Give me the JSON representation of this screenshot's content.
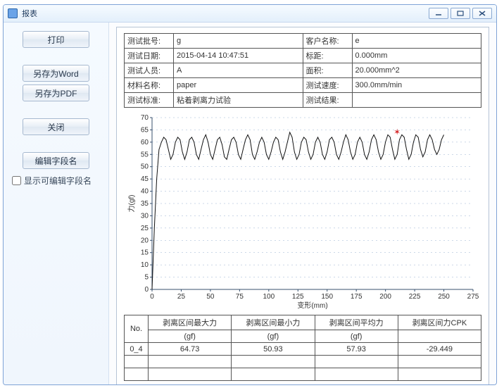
{
  "window": {
    "title": "报表"
  },
  "sidebar": {
    "print": "打印",
    "saveWord": "另存为Word",
    "savePdf": "另存为PDF",
    "close": "关闭",
    "editFieldNames": "编辑字段名",
    "showEditableLabel": "显示可编辑字段名"
  },
  "info": {
    "batchLabel": "测试批号:",
    "batchValue": "g",
    "customerLabel": "客户名称:",
    "customerValue": "e",
    "dateLabel": "测试日期:",
    "dateValue": "2015-04-14 10:47:51",
    "gaugeLabel": "标距:",
    "gaugeValue": "0.000mm",
    "operatorLabel": "测试人员:",
    "operatorValue": "A",
    "areaLabel": "面积:",
    "areaValue": "20.000mm^2",
    "materialLabel": "材料名称:",
    "materialValue": "paper",
    "speedLabel": "测试速度:",
    "speedValue": "300.0mm/min",
    "stdLabel": "测试标准:",
    "stdValue": "粘着剥离力试验",
    "resultLabel": "测试结果:",
    "resultValue": ""
  },
  "chart_data": {
    "type": "line",
    "title": "",
    "xlabel": "变形(mm)",
    "ylabel": "力(gf)",
    "xlim": [
      0,
      275
    ],
    "ylim": [
      0,
      70
    ],
    "xticks": [
      0,
      25,
      50,
      75,
      100,
      125,
      150,
      175,
      200,
      225,
      250,
      275
    ],
    "yticks": [
      0,
      5,
      10,
      15,
      20,
      25,
      30,
      35,
      40,
      45,
      50,
      55,
      60,
      65,
      70
    ],
    "gridY": true,
    "marker": {
      "x": 210,
      "y": 63,
      "label": "*"
    },
    "series": [
      {
        "name": "force",
        "x": [
          0,
          2,
          4,
          6,
          8,
          10,
          12,
          14,
          16,
          18,
          20,
          22,
          24,
          26,
          28,
          30,
          32,
          34,
          36,
          38,
          40,
          42,
          44,
          46,
          48,
          50,
          52,
          54,
          56,
          58,
          60,
          62,
          64,
          66,
          68,
          70,
          72,
          74,
          76,
          78,
          80,
          82,
          84,
          86,
          88,
          90,
          92,
          94,
          96,
          98,
          100,
          102,
          104,
          106,
          108,
          110,
          112,
          114,
          116,
          118,
          120,
          122,
          124,
          126,
          128,
          130,
          132,
          134,
          136,
          138,
          140,
          142,
          144,
          146,
          148,
          150,
          152,
          154,
          156,
          158,
          160,
          162,
          164,
          166,
          168,
          170,
          172,
          174,
          176,
          178,
          180,
          182,
          184,
          186,
          188,
          190,
          192,
          194,
          196,
          198,
          200,
          202,
          204,
          206,
          208,
          210,
          212,
          214,
          216,
          218,
          220,
          222,
          224,
          226,
          228,
          230,
          232,
          234,
          236,
          238,
          240,
          242,
          244,
          246,
          248,
          250
        ],
        "y": [
          0,
          25,
          45,
          57,
          60,
          62,
          61,
          57,
          53,
          55,
          60,
          62,
          61,
          56,
          53,
          56,
          61,
          62,
          60,
          55,
          53,
          57,
          61,
          63,
          60,
          55,
          53,
          57,
          61,
          62,
          59,
          54,
          53,
          57,
          61,
          62,
          60,
          55,
          53,
          57,
          61,
          63,
          61,
          55,
          53,
          56,
          60,
          62,
          60,
          55,
          53,
          56,
          60,
          62,
          61,
          56,
          53,
          56,
          60,
          64,
          62,
          56,
          53,
          55,
          60,
          62,
          61,
          56,
          53,
          55,
          60,
          62,
          60,
          55,
          53,
          56,
          61,
          62,
          60,
          55,
          53,
          56,
          60,
          63,
          61,
          56,
          53,
          55,
          60,
          62,
          60,
          55,
          53,
          56,
          61,
          63,
          61,
          56,
          53,
          55,
          60,
          63,
          62,
          57,
          53,
          55,
          61,
          63,
          62,
          57,
          53,
          55,
          60,
          63,
          62,
          57,
          54,
          56,
          61,
          63,
          61,
          57,
          55,
          57,
          61,
          63
        ]
      }
    ]
  },
  "results": {
    "colNo": "No.",
    "col1_top": "剥离区间最大力",
    "col1_bot": "(gf)",
    "col2_top": "剥离区间最小力",
    "col2_bot": "(gf)",
    "col3_top": "剥离区间平均力",
    "col3_bot": "(gf)",
    "col4_top": "剥离区间力CPK",
    "col4_bot": "",
    "row1": {
      "no": "0_4",
      "v1": "64.73",
      "v2": "50.93",
      "v3": "57.93",
      "v4": "-29.449"
    }
  }
}
